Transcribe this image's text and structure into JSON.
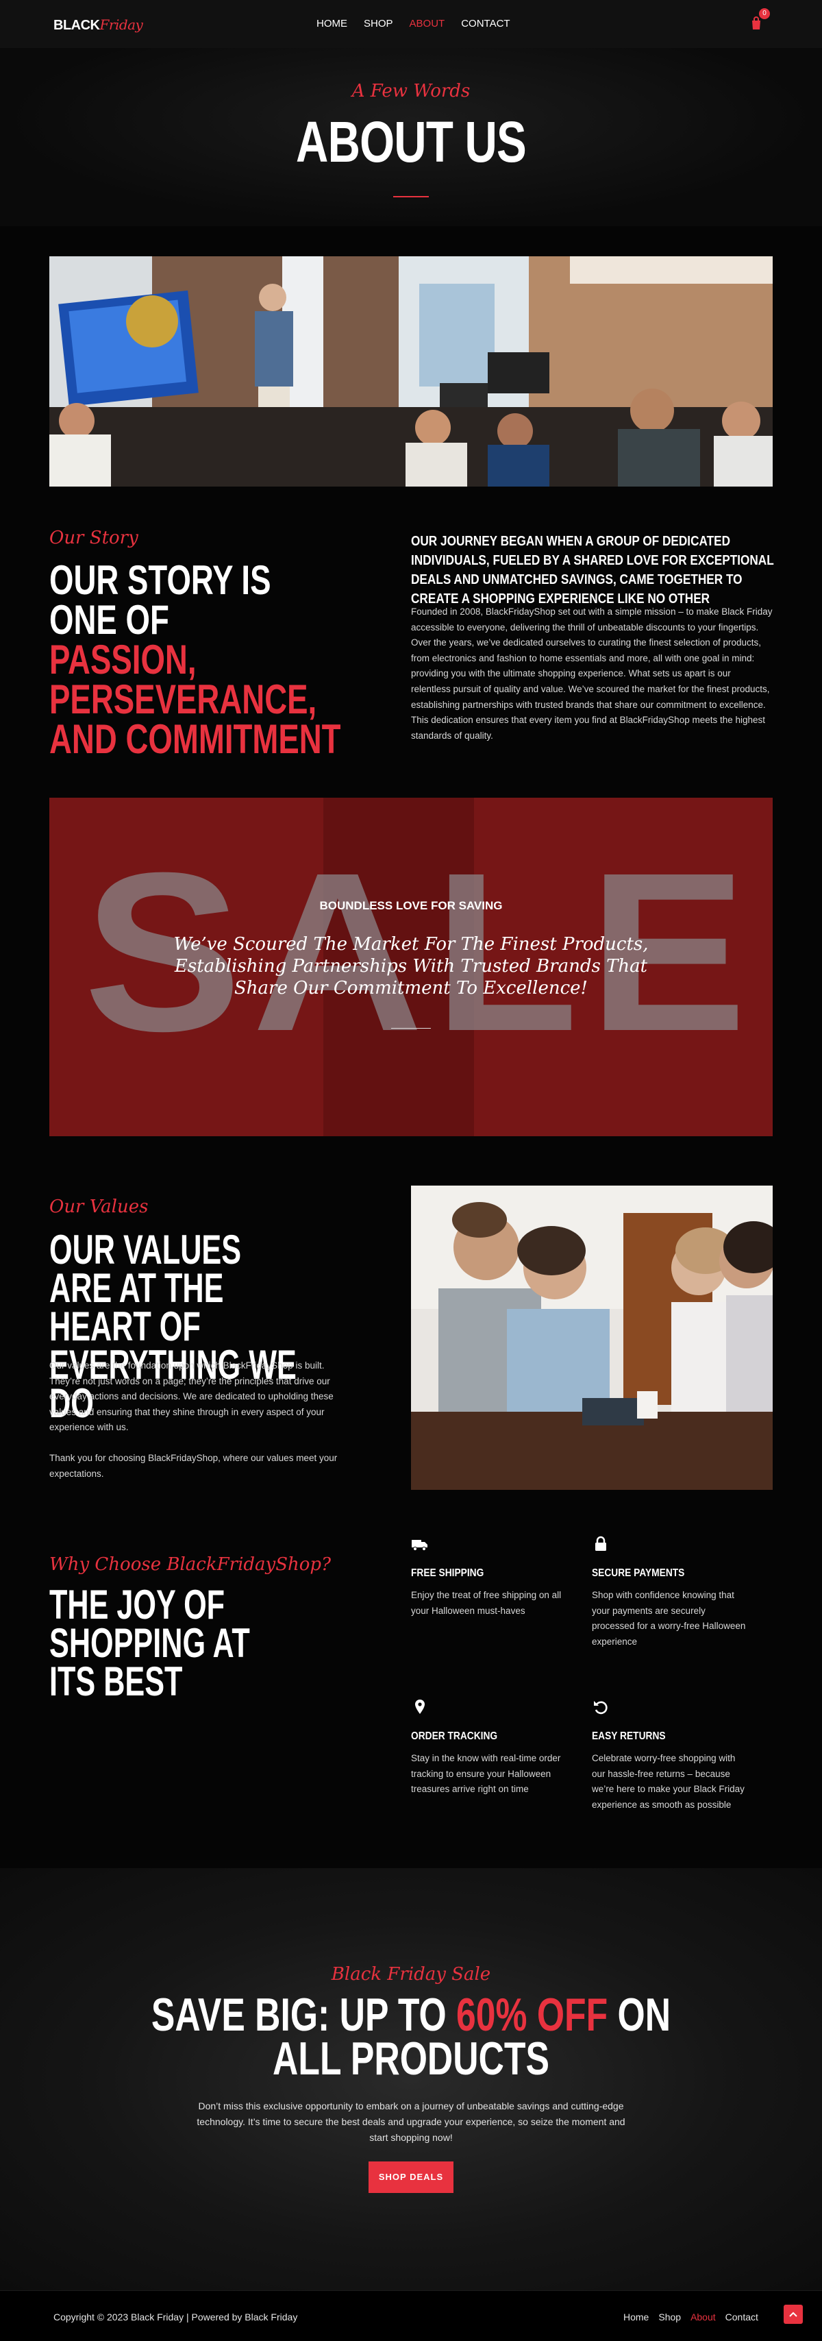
{
  "brand": {
    "part1": "BLACK",
    "part2": "Friday"
  },
  "nav": {
    "items": [
      "HOME",
      "SHOP",
      "ABOUT",
      "CONTACT"
    ],
    "active_index": 2
  },
  "cart": {
    "count": "0",
    "icon": "shopping-bag-icon"
  },
  "hero": {
    "subtitle": "A Few Words",
    "title": "ABOUT US"
  },
  "story": {
    "label": "Our Story",
    "title_white": "OUR STORY IS ONE OF",
    "title_accent": "PASSION, PERSEVERANCE, AND COMMITMENT",
    "heading": "OUR JOURNEY BEGAN WHEN A GROUP OF DEDICATED INDIVIDUALS, FUELED BY A SHARED LOVE FOR EXCEPTIONAL DEALS AND UNMATCHED SAVINGS, CAME TOGETHER TO CREATE A SHOPPING EXPERIENCE LIKE NO OTHER",
    "body": "Founded in 2008, BlackFridayShop set out with a simple mission – to make Black Friday accessible to everyone, delivering the thrill of unbeatable discounts to your fingertips. Over the years, we’ve dedicated ourselves to curating the finest selection of products, from electronics and fashion to home essentials and more, all with one goal in mind: providing you with the ultimate shopping experience. What sets us apart is our relentless pursuit of quality and value. We’ve scoured the market for the finest products, establishing partnerships with trusted brands that share our commitment to excellence. This dedication ensures that every item you find at BlackFridayShop meets the highest standards of quality."
  },
  "sale_banner": {
    "background_word": "SALE",
    "tag": "BOUNDLESS LOVE FOR SAVING",
    "quote": "We’ve Scoured The Market For The Finest Products, Establishing Partnerships With Trusted Brands That Share Our Commitment To Excellence!"
  },
  "values": {
    "label": "Our Values",
    "title": "OUR VALUES ARE AT THE HEART OF EVERYTHING WE DO",
    "body1": "Our values are the foundation upon which BlackFridayShop is built. They’re not just words on a page; they’re the principles that drive our everyday actions and decisions. We are dedicated to upholding these values and ensuring that they shine through in every aspect of your experience with us.",
    "body2": "Thank you for choosing BlackFridayShop, where our values meet your expectations."
  },
  "why": {
    "label": "Why Choose BlackFridayShop?",
    "title": "THE JOY OF SHOPPING AT ITS BEST",
    "features": [
      {
        "icon": "truck-icon",
        "title": "FREE SHIPPING",
        "desc": "Enjoy the treat of free shipping on all your Halloween must-haves"
      },
      {
        "icon": "lock-icon",
        "title": "SECURE PAYMENTS",
        "desc": "Shop with confidence knowing that your payments are securely processed for a worry-free Halloween experience"
      },
      {
        "icon": "map-pin-icon",
        "title": "ORDER TRACKING",
        "desc": "Stay in the know with real-time order tracking to ensure your Halloween treasures arrive right on time"
      },
      {
        "icon": "undo-icon",
        "title": "EASY RETURNS",
        "desc": "Celebrate worry-free shopping with our hassle-free returns – because we’re here to make your Black Friday experience as smooth as possible"
      }
    ]
  },
  "promo": {
    "label": "Black Friday Sale",
    "title_part1": "SAVE BIG: UP TO ",
    "title_accent": "60% OFF",
    "title_part2": " ON ALL PRODUCTS",
    "text": "Don’t miss this exclusive opportunity to embark on a journey of unbeatable savings and cutting-edge technology. It’s time to secure the best deals and upgrade your experience, so seize the moment and start shopping now!",
    "button": "SHOP DEALS"
  },
  "footer": {
    "copyright": "Copyright © 2023 Black Friday | Powered by Black Friday",
    "links": [
      "Home",
      "Shop",
      "About",
      "Contact"
    ],
    "active_index": 2
  },
  "colors": {
    "accent": "#e8323f",
    "background": "#050505"
  }
}
